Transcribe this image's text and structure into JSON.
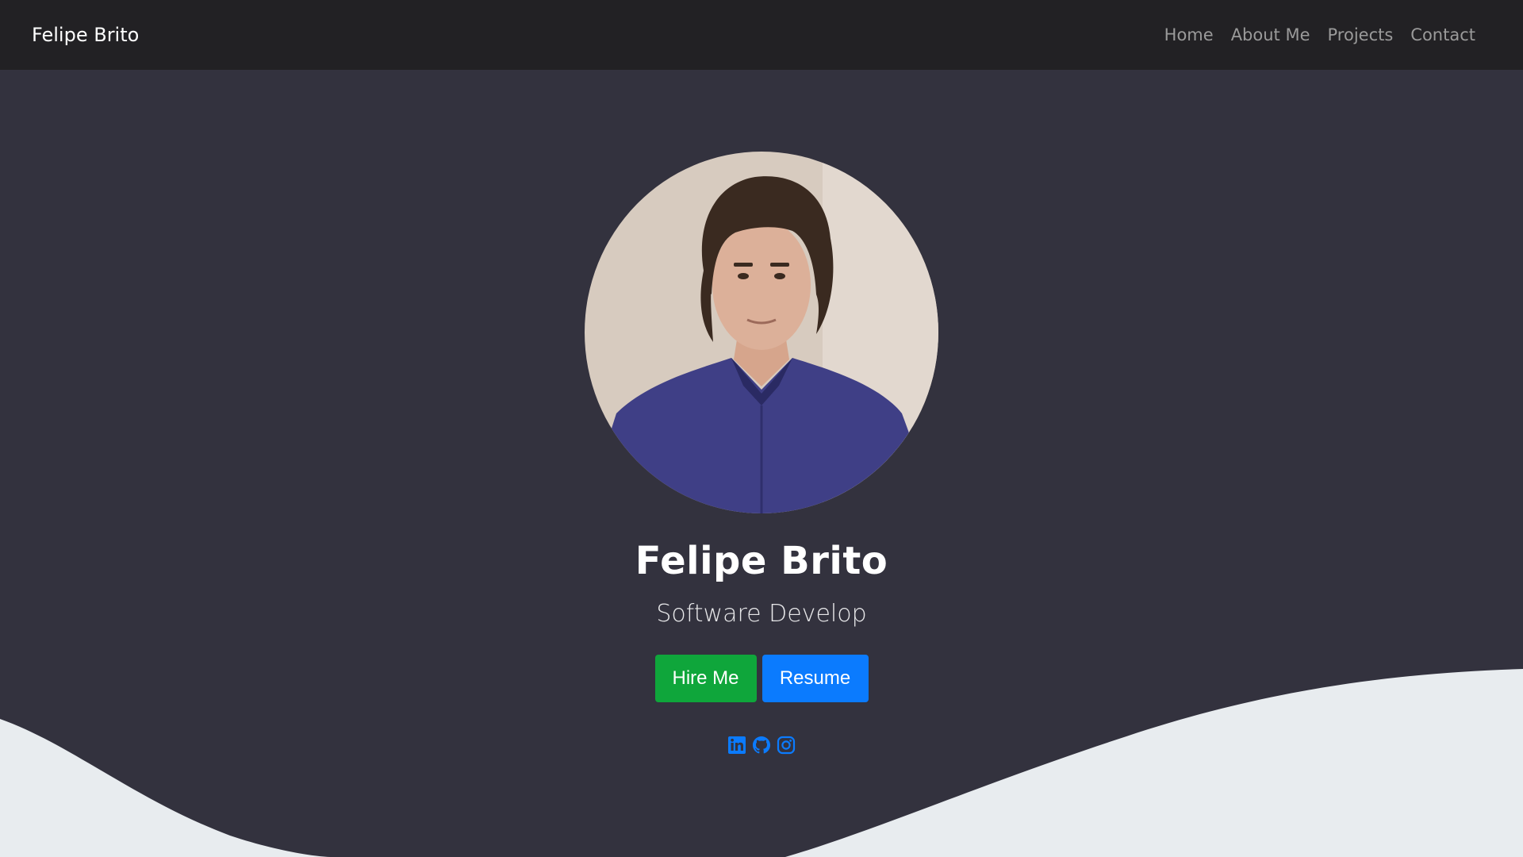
{
  "navbar": {
    "brand": "Felipe Brito",
    "links": [
      {
        "label": "Home"
      },
      {
        "label": "About Me"
      },
      {
        "label": "Projects"
      },
      {
        "label": "Contact"
      }
    ]
  },
  "hero": {
    "name": "Felipe Brito",
    "subtitle": "Software Develop",
    "hire_label": "Hire Me",
    "resume_label": "Resume",
    "socials": [
      {
        "icon": "linkedin-icon"
      },
      {
        "icon": "github-icon"
      },
      {
        "icon": "instagram-icon"
      }
    ]
  },
  "colors": {
    "navbar_bg": "#222124",
    "hero_bg": "#33323e",
    "wave": "#e8ecef",
    "hire": "#0fa63b",
    "resume": "#0b7bfe",
    "social": "#0b7bfe"
  }
}
